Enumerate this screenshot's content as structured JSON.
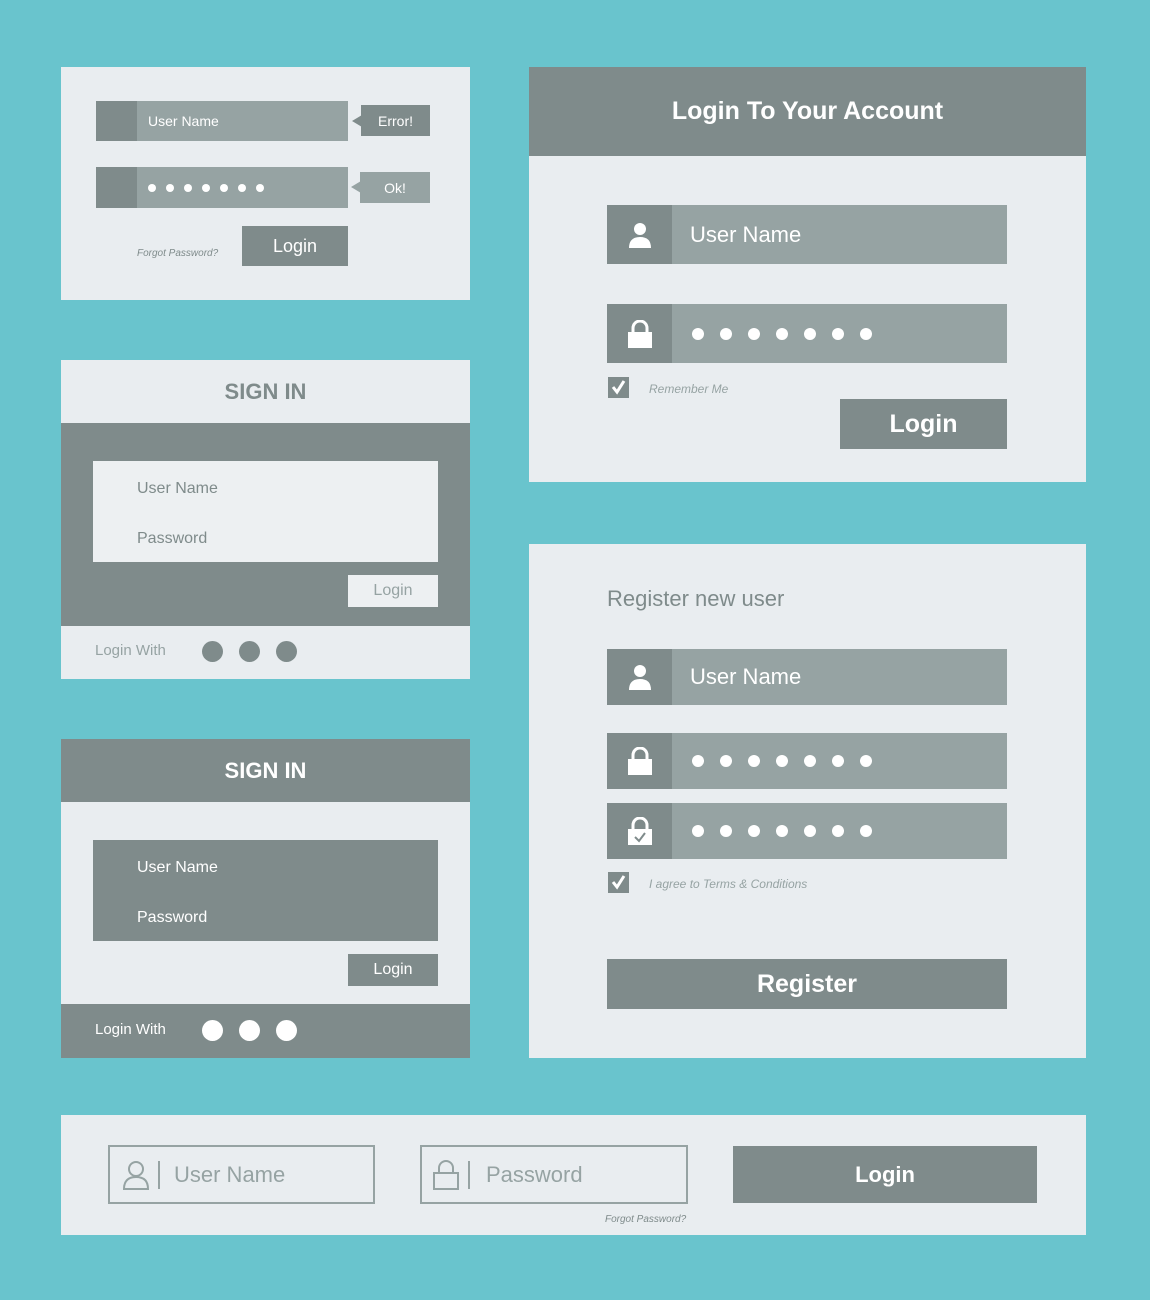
{
  "widget1": {
    "username_placeholder": "User Name",
    "error_tooltip": "Error!",
    "ok_tooltip": "Ok!",
    "forgot_password": "Forgot Password?",
    "login_button": "Login"
  },
  "widget2": {
    "title": "Login To Your Account",
    "username_placeholder": "User Name",
    "remember_me": "Remember Me",
    "login_button": "Login"
  },
  "widget3": {
    "title": "SIGN IN",
    "username_label": "User Name",
    "password_label": "Password",
    "login_button": "Login",
    "login_with": "Login With"
  },
  "widget4": {
    "title": "SIGN IN",
    "username_label": "User Name",
    "password_label": "Password",
    "login_button": "Login",
    "login_with": "Login With"
  },
  "widget5": {
    "title": "Register new user",
    "username_placeholder": "User Name",
    "agree_terms": "I agree to Terms & Conditions",
    "register_button": "Register"
  },
  "widget6": {
    "username_placeholder": "User Name",
    "password_placeholder": "Password",
    "forgot_password": "Forgot Password?",
    "login_button": "Login"
  },
  "colors": {
    "background": "#69c4cd",
    "panel": "#e9edf0",
    "dark": "#7f8b8b",
    "mid": "#96a3a3"
  }
}
